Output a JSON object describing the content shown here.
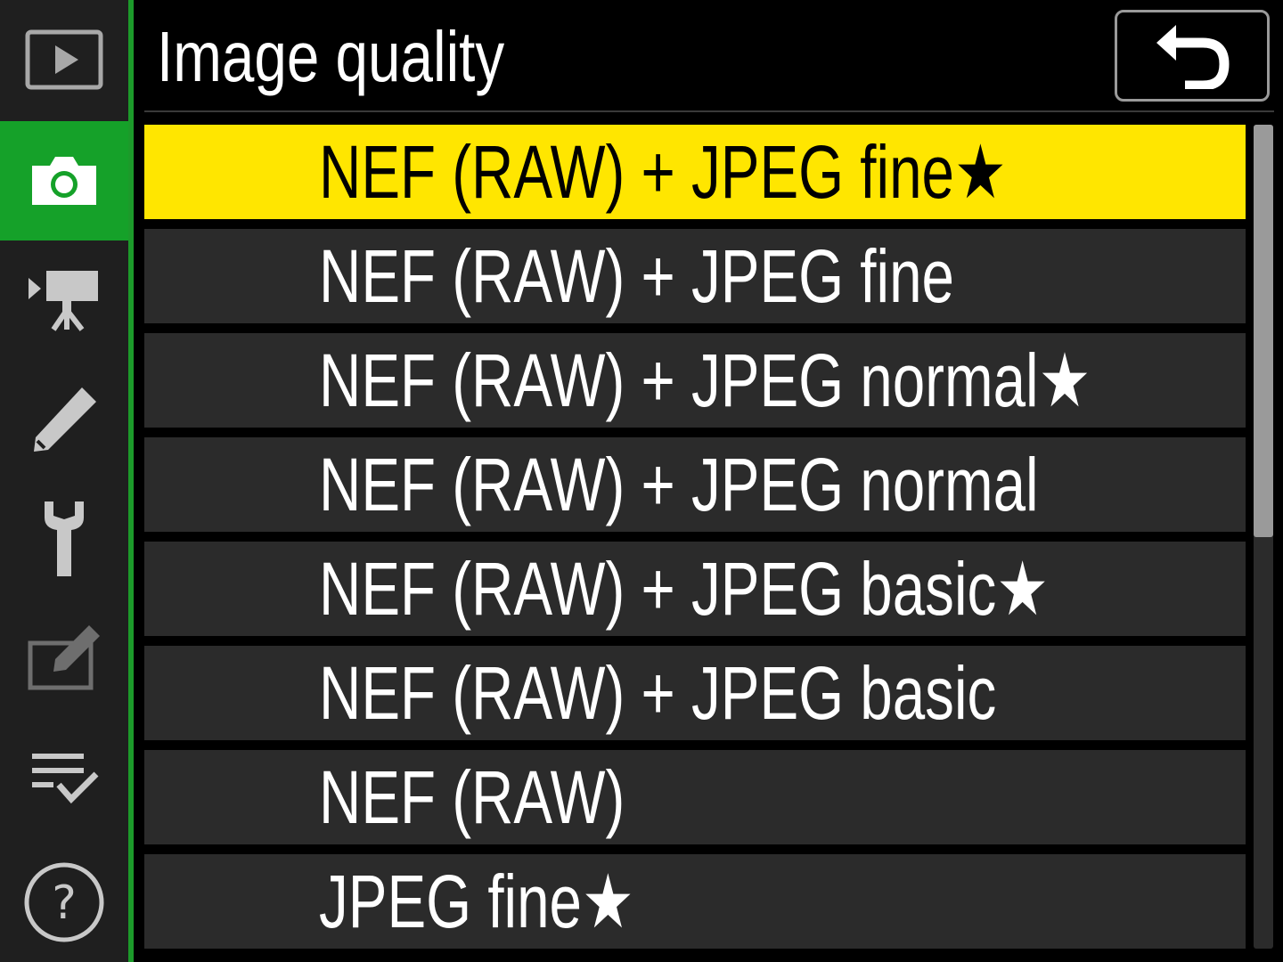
{
  "header": {
    "title": "Image quality",
    "back_icon": "back-arrow-icon"
  },
  "sidebar": {
    "items": [
      {
        "icon": "playback-icon",
        "active": false
      },
      {
        "icon": "camera-icon",
        "active": true
      },
      {
        "icon": "movie-icon",
        "active": false
      },
      {
        "icon": "pencil-icon",
        "active": false
      },
      {
        "icon": "wrench-icon",
        "active": false
      },
      {
        "icon": "retouch-icon",
        "active": false
      },
      {
        "icon": "my-menu-icon",
        "active": false
      },
      {
        "icon": "help-icon",
        "active": false
      }
    ]
  },
  "options": [
    {
      "label": "NEF (RAW) + JPEG fine★",
      "selected": true
    },
    {
      "label": "NEF (RAW) + JPEG fine",
      "selected": false
    },
    {
      "label": "NEF (RAW) + JPEG normal★",
      "selected": false
    },
    {
      "label": "NEF (RAW) + JPEG normal",
      "selected": false
    },
    {
      "label": "NEF (RAW) + JPEG basic★",
      "selected": false
    },
    {
      "label": "NEF (RAW) + JPEG basic",
      "selected": false
    },
    {
      "label": "NEF (RAW)",
      "selected": false
    },
    {
      "label": "JPEG fine★",
      "selected": false
    }
  ],
  "scrollbar": {
    "position": 0,
    "visible_fraction": 0.5
  },
  "colors": {
    "highlight": "#ffe600",
    "active_tab": "#15a129",
    "row_bg": "#2b2b2b"
  }
}
